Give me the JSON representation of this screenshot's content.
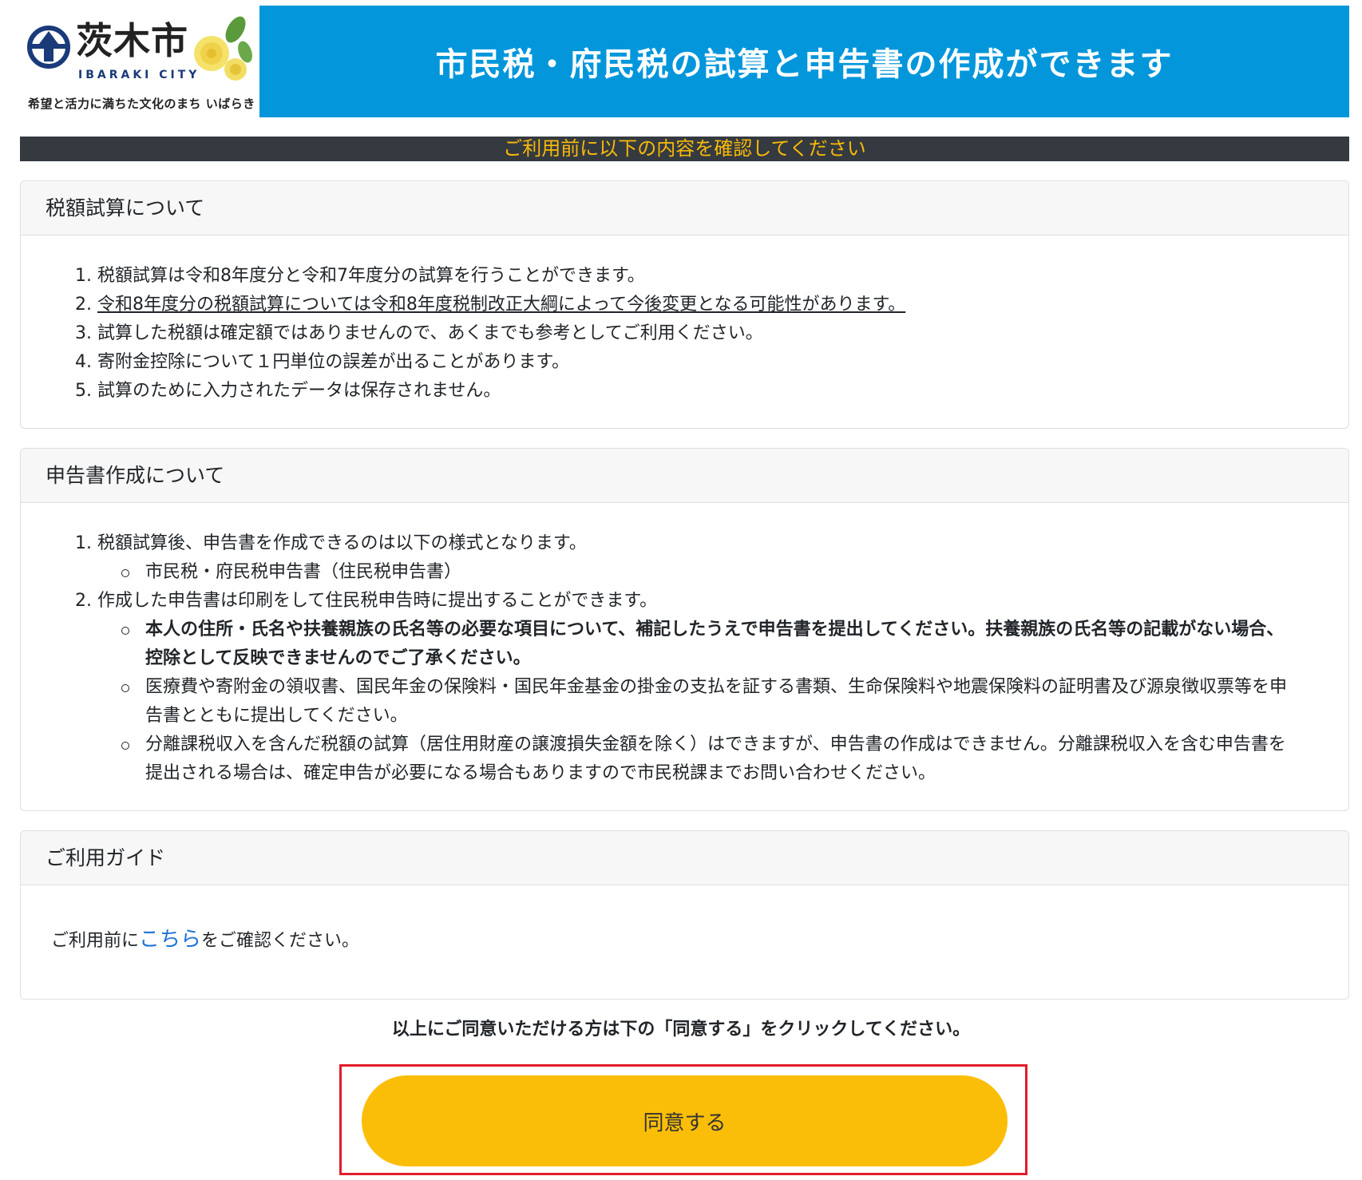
{
  "logo": {
    "name": "茨木市",
    "roman": "IBARAKI CITY",
    "motto": "希望と活力に満ちた文化のまち いばらき"
  },
  "header": {
    "title": "市民税・府民税の試算と申告書の作成ができます"
  },
  "notice": "ご利用前に以下の内容を確認してください",
  "sections": {
    "tax": {
      "title": "税額試算について",
      "items": [
        "税額試算は令和8年度分と令和7年度分の試算を行うことができます。",
        "令和8年度分の税額試算については令和8年度税制改正大綱によって今後変更となる可能性があります。",
        "試算した税額は確定額ではありませんので、あくまでも参考としてご利用ください。",
        "寄附金控除について１円単位の誤差が出ることがあります。",
        "試算のために入力されたデータは保存されません。"
      ]
    },
    "form": {
      "title": "申告書作成について",
      "item1": "税額試算後、申告書を作成できるのは以下の様式となります。",
      "item1_sub": "市民税・府民税申告書（住民税申告書）",
      "item2": "作成した申告書は印刷をして住民税申告時に提出することができます。",
      "item2_subs": [
        "本人の住所・氏名や扶養親族の氏名等の必要な項目について、補記したうえで申告書を提出してください。扶養親族の氏名等の記載がない場合、控除として反映できませんのでご了承ください。",
        "医療費や寄附金の領収書、国民年金の保険料・国民年金基金の掛金の支払を証する書類、生命保険料や地震保険料の証明書及び源泉徴収票等を申告書とともに提出してください。",
        "分離課税収入を含んだ税額の試算（居住用財産の譲渡損失金額を除く）はできますが、申告書の作成はできません。分離課税収入を含む申告書を提出される場合は、確定申告が必要になる場合もありますので市民税課までお問い合わせください。"
      ]
    },
    "guide": {
      "title": "ご利用ガイド",
      "text_before": "ご利用前に",
      "link": "こちら",
      "text_after": "をご確認ください。"
    }
  },
  "agree": {
    "message": "以上にご同意いただける方は下の「同意する」をクリックしてください。",
    "button": "同意する"
  },
  "colors": {
    "title_bar": "#0396db",
    "notice_bg": "#343a40",
    "notice_text": "#f9b908",
    "agree_button": "#fbbe08",
    "highlight_frame": "#e21c2a",
    "link": "#1e74d6"
  }
}
